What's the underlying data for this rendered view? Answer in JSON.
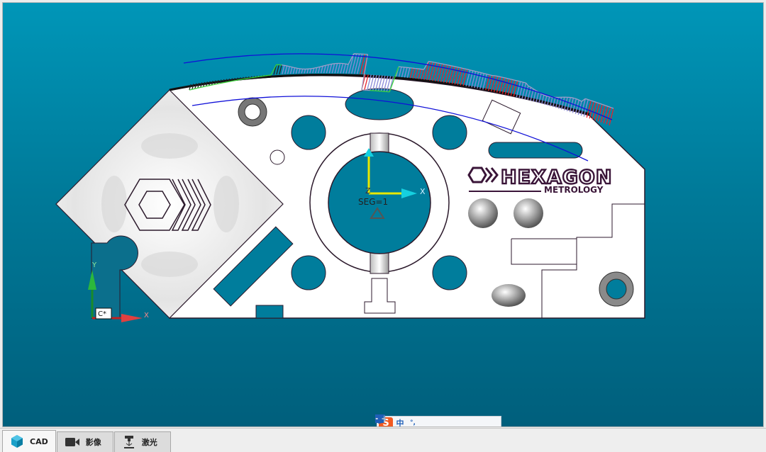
{
  "viewport": {
    "logo": {
      "brand": "HEXAGON",
      "sub": "METROLOGY"
    },
    "labels": {
      "seg": "SEG=1",
      "z": "Z",
      "x": "X",
      "y": "Y",
      "lcs_x": "X",
      "lcs": "C*"
    }
  },
  "ime": {
    "logo": "S",
    "lang": "中",
    "punct": "°,",
    "items": [
      "smile-icon",
      "mic-icon",
      "keyboard-icon",
      "tools-icon",
      "shirt-icon",
      "grid-icon"
    ]
  },
  "tabs": [
    {
      "label": "CAD",
      "icon": "cube-icon",
      "active": true
    },
    {
      "label": "影像",
      "icon": "camera-icon",
      "active": false
    },
    {
      "label": "激光",
      "icon": "laser-icon",
      "active": false
    }
  ],
  "colors": {
    "bg_top": "#0096b8",
    "bg_bottom": "#005f7c",
    "part": "#ffffff",
    "hole": "#007d9c",
    "outline": "#3a1f3a",
    "arc": "#1010d8",
    "deviation_red": "#e8222a",
    "deviation_blue": "#8a8ad8",
    "brand": "#3a1538"
  }
}
